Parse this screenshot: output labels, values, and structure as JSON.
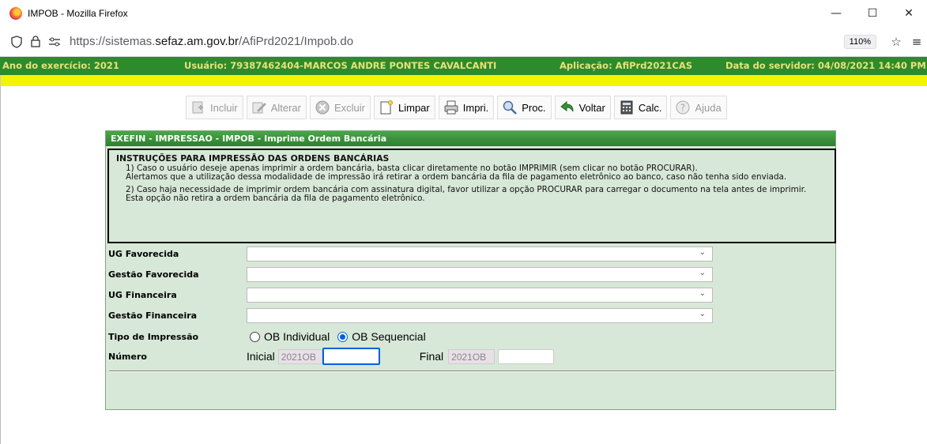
{
  "window": {
    "title": "IMPOB - Mozilla Firefox",
    "controls": {
      "minimize": "—",
      "maximize": "☐",
      "close": "✕"
    }
  },
  "nav": {
    "url_prefix": "https://sistemas.",
    "url_domain": "sefaz.am.gov.br",
    "url_path": "/AfiPrd2021/Impob.do",
    "zoom": "110%"
  },
  "header": {
    "ano": "Ano do exercício: 2021",
    "usuario": "Usuário: 79387462404-MARCOS ANDRE PONTES CAVALCANTI",
    "aplicacao": "Aplicação: AfiPrd2021CAS",
    "data_servidor": "Data do servidor: 04/08/2021 14:40 PM"
  },
  "toolbar": {
    "incluir": "Incluir",
    "alterar": "Alterar",
    "excluir": "Excluir",
    "limpar": "Limpar",
    "imprimir": "Impri.",
    "procurar": "Proc.",
    "voltar": "Voltar",
    "calc": "Calc.",
    "ajuda": "Ajuda"
  },
  "panel": {
    "title": "EXEFIN - IMPRESSAO - IMPOB - Imprime Ordem Bancária",
    "instructions": {
      "heading": "INSTRUÇÕES PARA IMPRESSÃO DAS ORDENS BANCÁRIAS",
      "p1": "1) Caso o usuário deseje apenas imprimir a ordem bancária, basta clicar diretamente no botão IMPRIMIR (sem clicar no botão PROCURAR).",
      "p1b": "Alertamos que a utilização dessa modalidade de impressão irá retirar a ordem bancária da fila de pagamento eletrônico ao banco, caso não tenha sido enviada.",
      "p2": "2) Caso haja necessidade de imprimir ordem bancária com assinatura digital, favor utilizar a opção PROCURAR para carregar o documento na tela antes de imprimir.",
      "p2b": "Esta opção não retira a ordem bancária da fila de pagamento eletrônico."
    },
    "fields": {
      "ug_favorecida": "UG Favorecida",
      "gestao_favorecida": "Gestão Favorecida",
      "ug_financeira": "UG Financeira",
      "gestao_financeira": "Gestão Financeira",
      "tipo_impressao": "Tipo de Impressão",
      "numero": "Número"
    },
    "tipo": {
      "individual": "OB Individual",
      "sequencial": "OB Sequencial",
      "selected": "OB Sequencial"
    },
    "numero": {
      "inicial_label": "Inicial",
      "inicial_prefix": "2021OB",
      "inicial_value": "",
      "final_label": "Final",
      "final_prefix": "2021OB",
      "final_value": ""
    }
  }
}
